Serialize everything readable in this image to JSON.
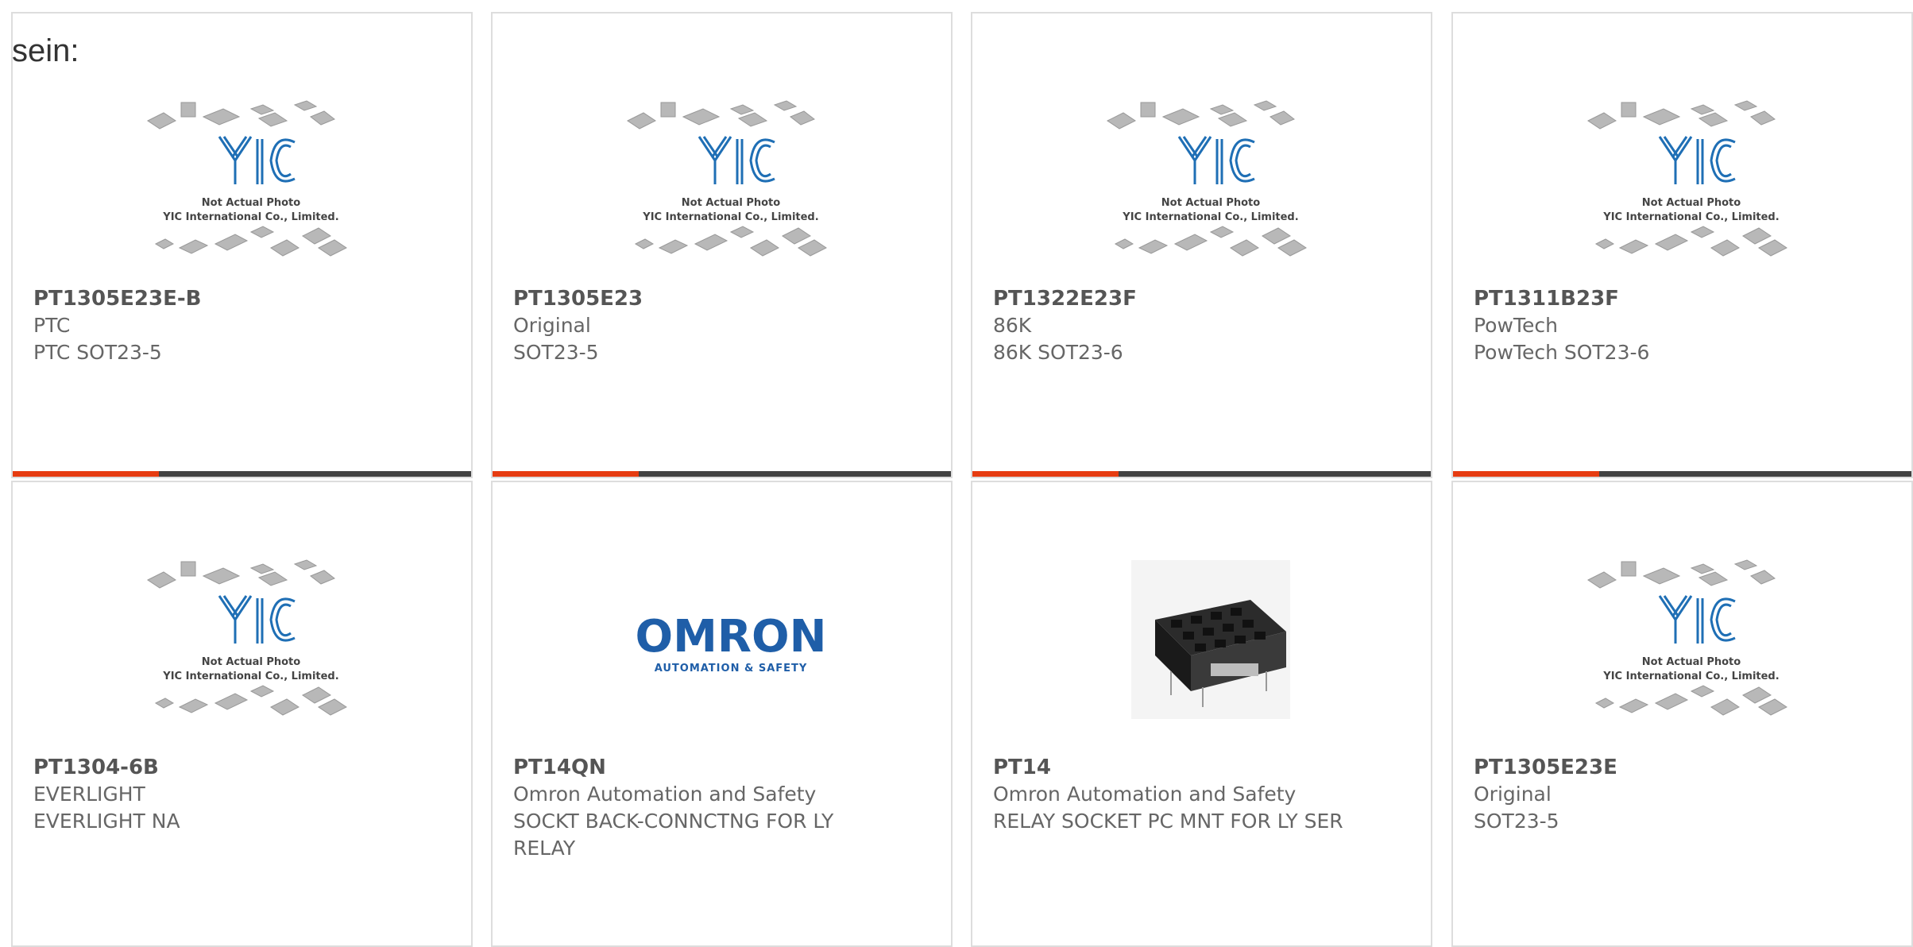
{
  "intro_text": "sein:",
  "placeholder_photo": {
    "caption_line1": "Not Actual Photo",
    "caption_line2": "YIC International Co., Limited.",
    "logo_text": "YIC"
  },
  "omron_logo": {
    "brand": "OMRON",
    "tagline": "AUTOMATION & SAFETY",
    "brand_color": "#1f5ea8"
  },
  "colors": {
    "accent_bar": "#e63c11",
    "dark_bar": "#424242",
    "yic_blue": "#1f6fb5"
  },
  "products": [
    {
      "part": "PT1305E23E-B",
      "line1": "PTC",
      "line2": "PTC SOT23-5",
      "image": "yic-placeholder"
    },
    {
      "part": "PT1305E23",
      "line1": "Original",
      "line2": "SOT23-5",
      "image": "yic-placeholder"
    },
    {
      "part": "PT1322E23F",
      "line1": "86K",
      "line2": "86K SOT23-6",
      "image": "yic-placeholder"
    },
    {
      "part": "PT1311B23F",
      "line1": "PowTech",
      "line2": "PowTech SOT23-6",
      "image": "yic-placeholder"
    },
    {
      "part": "PT1304-6B",
      "line1": "EVERLIGHT",
      "line2": "EVERLIGHT NA",
      "image": "yic-placeholder"
    },
    {
      "part": "PT14QN",
      "line1": "Omron Automation and Safety",
      "line2": "SOCKT BACK-CONNCTNG FOR LY RELAY",
      "image": "omron-logo"
    },
    {
      "part": "PT14",
      "line1": "Omron Automation and Safety",
      "line2": "RELAY SOCKET PC MNT FOR LY SER",
      "image": "relay-socket-photo"
    },
    {
      "part": "PT1305E23E",
      "line1": "Original",
      "line2": "SOT23-5",
      "image": "yic-placeholder"
    }
  ]
}
